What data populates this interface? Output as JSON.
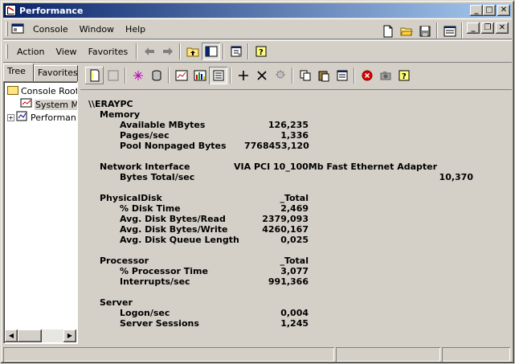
{
  "window": {
    "title": "Performance"
  },
  "console_menu": [
    "Console",
    "Window",
    "Help"
  ],
  "action_menu": [
    "Action",
    "View",
    "Favorites"
  ],
  "left_tabs": [
    "Tree",
    "Favorites"
  ],
  "tree": [
    {
      "label": "Console Root"
    },
    {
      "label": "System M"
    },
    {
      "label": "Performan"
    }
  ],
  "report": {
    "host": "\\\\ERAYPC",
    "sections": [
      {
        "object": "Memory",
        "instance": "",
        "counters": [
          {
            "name": "Available MBytes",
            "value": "126,235"
          },
          {
            "name": "Pages/sec",
            "value": "1,336"
          },
          {
            "name": "Pool Nonpaged Bytes",
            "value": "7768453,120"
          }
        ]
      },
      {
        "object": "Network Interface",
        "instance": "VIA PCI 10_100Mb Fast Ethernet Adapter",
        "counters": [
          {
            "name": "Bytes Total/sec",
            "value": "10,370"
          }
        ]
      },
      {
        "object": "PhysicalDisk",
        "instance": "_Total",
        "counters": [
          {
            "name": "% Disk Time",
            "value": "2,469"
          },
          {
            "name": "Avg. Disk Bytes/Read",
            "value": "2379,093"
          },
          {
            "name": "Avg. Disk Bytes/Write",
            "value": "4260,167"
          },
          {
            "name": "Avg. Disk Queue Length",
            "value": "0,025"
          }
        ]
      },
      {
        "object": "Processor",
        "instance": "_Total",
        "counters": [
          {
            "name": "% Processor Time",
            "value": "3,077"
          },
          {
            "name": "Interrupts/sec",
            "value": "991,366"
          }
        ]
      },
      {
        "object": "Server",
        "instance": "",
        "counters": [
          {
            "name": "Logon/sec",
            "value": "0,004"
          },
          {
            "name": "Server Sessions",
            "value": "1,245"
          }
        ]
      }
    ]
  },
  "colors": {
    "title_gradient_start": "#0a246a",
    "title_gradient_end": "#a6caf0",
    "face": "#d4d0c8"
  }
}
